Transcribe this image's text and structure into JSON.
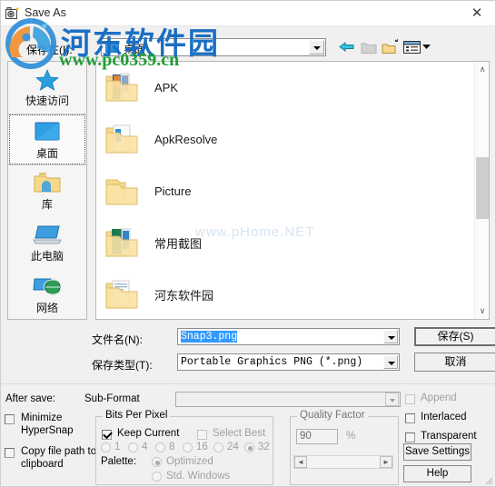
{
  "window": {
    "title": "Save As",
    "icon": "camera-icon",
    "close_label": "✕"
  },
  "toolbar": {
    "lookin_label": "保存在(I):",
    "lookin_value": "桌面",
    "buttons": [
      {
        "name": "back-button",
        "title": "Back"
      },
      {
        "name": "up-folder-button",
        "title": "Up one level"
      },
      {
        "name": "new-folder-button",
        "title": "New Folder"
      },
      {
        "name": "views-button",
        "title": "Views"
      }
    ]
  },
  "places": {
    "items": [
      {
        "label": "快速访问",
        "icon": "star-icon",
        "selected": false
      },
      {
        "label": "桌面",
        "icon": "desktop-icon",
        "selected": true
      },
      {
        "label": "库",
        "icon": "library-folder-icon",
        "selected": false
      },
      {
        "label": "此电脑",
        "icon": "this-pc-icon",
        "selected": false
      },
      {
        "label": "网络",
        "icon": "network-icon",
        "selected": false
      }
    ]
  },
  "filelist": {
    "items": [
      {
        "name": "APK",
        "icon": "folder-apk-icon"
      },
      {
        "name": "ApkResolve",
        "icon": "folder-doc-icon"
      },
      {
        "name": "Picture",
        "icon": "folder-plain-icon"
      },
      {
        "name": "常用截图",
        "icon": "folder-windows-icon"
      },
      {
        "name": "河东软件园",
        "icon": "folder-docs-icon"
      }
    ],
    "scrollbar": {
      "up": "∧",
      "down": "∨"
    }
  },
  "form": {
    "filename_label": "文件名(N):",
    "filename_value": "Snap3.png",
    "filetype_label": "保存类型(T):",
    "filetype_value": "Portable Graphics PNG (*.png)",
    "save_button": "保存(S)",
    "cancel_button": "取消"
  },
  "options": {
    "after_save_label": "After save:",
    "minimize_label_line1": "Minimize",
    "minimize_label_line2": "HyperSnap",
    "minimize_checked": false,
    "copy_path_line1": "Copy file path to",
    "copy_path_line2": "clipboard",
    "copy_path_checked": false,
    "subformat_label": "Sub-Format",
    "subformat_value": "",
    "bpp_group_label": "Bits Per Pixel",
    "keep_current_label": "Keep Current",
    "keep_current_checked": true,
    "select_best_label": "Select Best",
    "select_best_checked": false,
    "bpp_options": [
      "1",
      "4",
      "8",
      "16",
      "24",
      "32"
    ],
    "bpp_selected": "32",
    "palette_label": "Palette:",
    "palette_options": [
      "Optimized",
      "Std. Windows"
    ],
    "palette_selected": "Optimized",
    "quality_group_label": "Quality Factor",
    "quality_value": "90",
    "quality_unit": "%",
    "scroll_left": "◄",
    "scroll_right": "►",
    "append_label": "Append",
    "append_checked": false,
    "interlaced_label": "Interlaced",
    "interlaced_checked": false,
    "transparent_label": "Transparent",
    "transparent_checked": false,
    "save_settings_button": "Save Settings",
    "help_button": "Help"
  },
  "watermark": {
    "site_name": "河东软件园",
    "site_url": "www.pc0359.cn",
    "faint_text": "www.pHome.NET"
  },
  "colors": {
    "accent_blue": "#1a6fc4",
    "accent_green": "#1f9d35",
    "selection_blue": "#3399ff",
    "folder_yellow": "#f7d88c",
    "window_bg": "#f0f0f0"
  }
}
